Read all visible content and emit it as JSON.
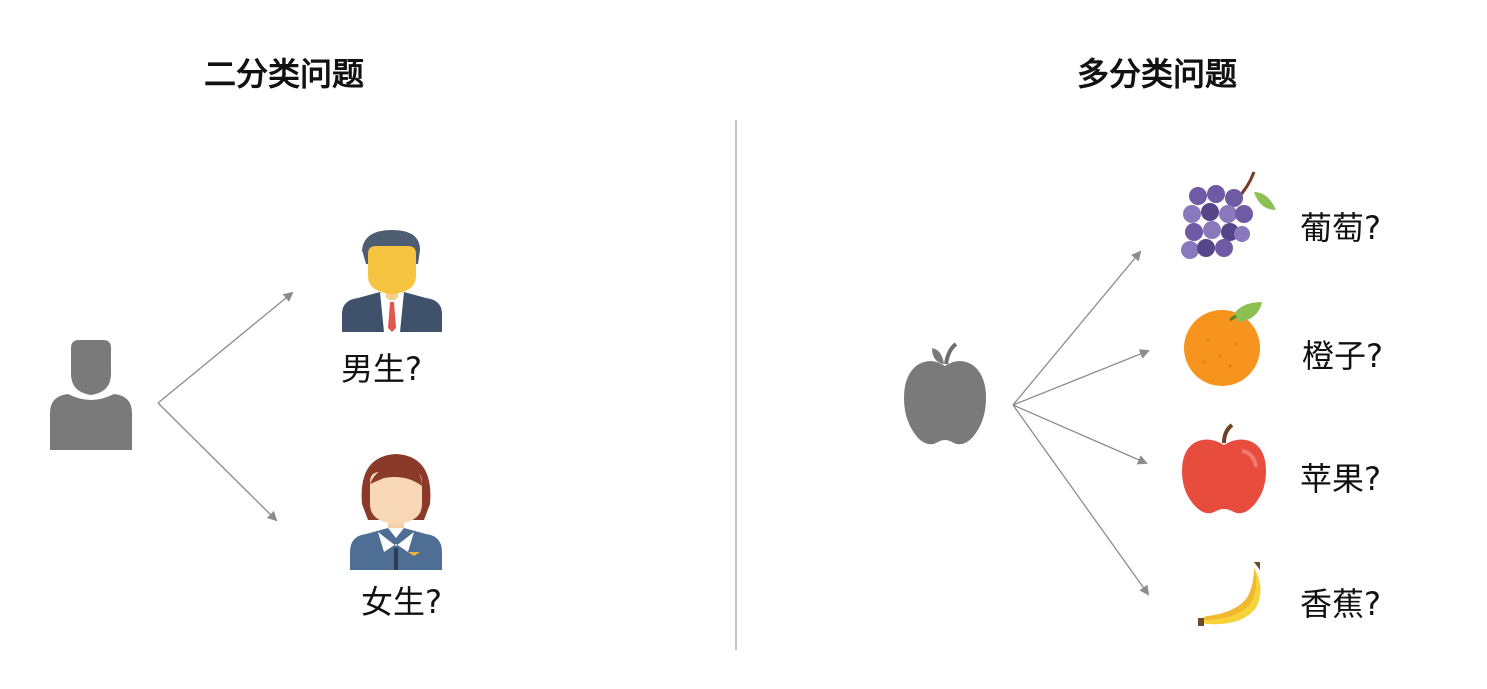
{
  "left_panel": {
    "title": "二分类问题",
    "options": [
      {
        "label": "男生?",
        "icon": "male-avatar-icon"
      },
      {
        "label": "女生?",
        "icon": "female-avatar-icon"
      }
    ],
    "source_icon": "person-silhouette-icon"
  },
  "right_panel": {
    "title": "多分类问题",
    "options": [
      {
        "label": "葡萄?",
        "icon": "grapes-icon"
      },
      {
        "label": "橙子?",
        "icon": "orange-icon"
      },
      {
        "label": "苹果?",
        "icon": "red-apple-icon"
      },
      {
        "label": "香蕉?",
        "icon": "banana-icon"
      }
    ],
    "source_icon": "gray-apple-icon"
  },
  "colors": {
    "arrow": "#8c8c8c",
    "silhouette": "#7a7a7a",
    "divider": "#c4c4c4"
  }
}
